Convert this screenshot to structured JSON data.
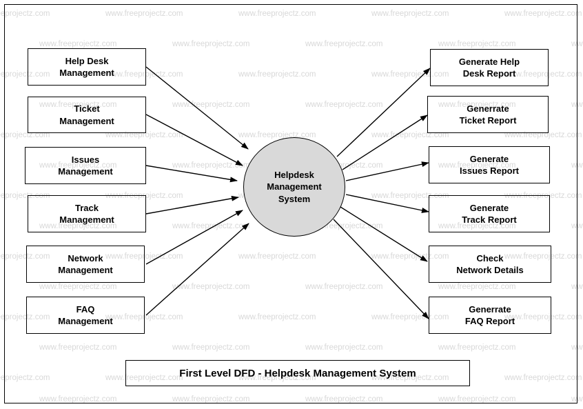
{
  "diagram": {
    "title": "First Level DFD - Helpdesk Management System",
    "process": {
      "label": "Helpdesk\nManagement\nSystem",
      "fill": "#d9d9d9"
    },
    "inputs": [
      {
        "label": "Help Desk\nManagement"
      },
      {
        "label": "Ticket\nManagement"
      },
      {
        "label": "Issues\nManagement"
      },
      {
        "label": "Track\nManagement"
      },
      {
        "label": "Network\nManagement"
      },
      {
        "label": "FAQ\nManagement"
      }
    ],
    "outputs": [
      {
        "label": "Generate Help\nDesk Report"
      },
      {
        "label": "Generrate\nTicket Report"
      },
      {
        "label": "Generate\nIssues Report"
      },
      {
        "label": "Generate\nTrack Report"
      },
      {
        "label": "Check\nNetwork Details"
      },
      {
        "label": "Generrate\nFAQ Report"
      }
    ]
  },
  "watermark": {
    "text": "www.freeprojectz.com",
    "color": "#d8d8d8"
  }
}
